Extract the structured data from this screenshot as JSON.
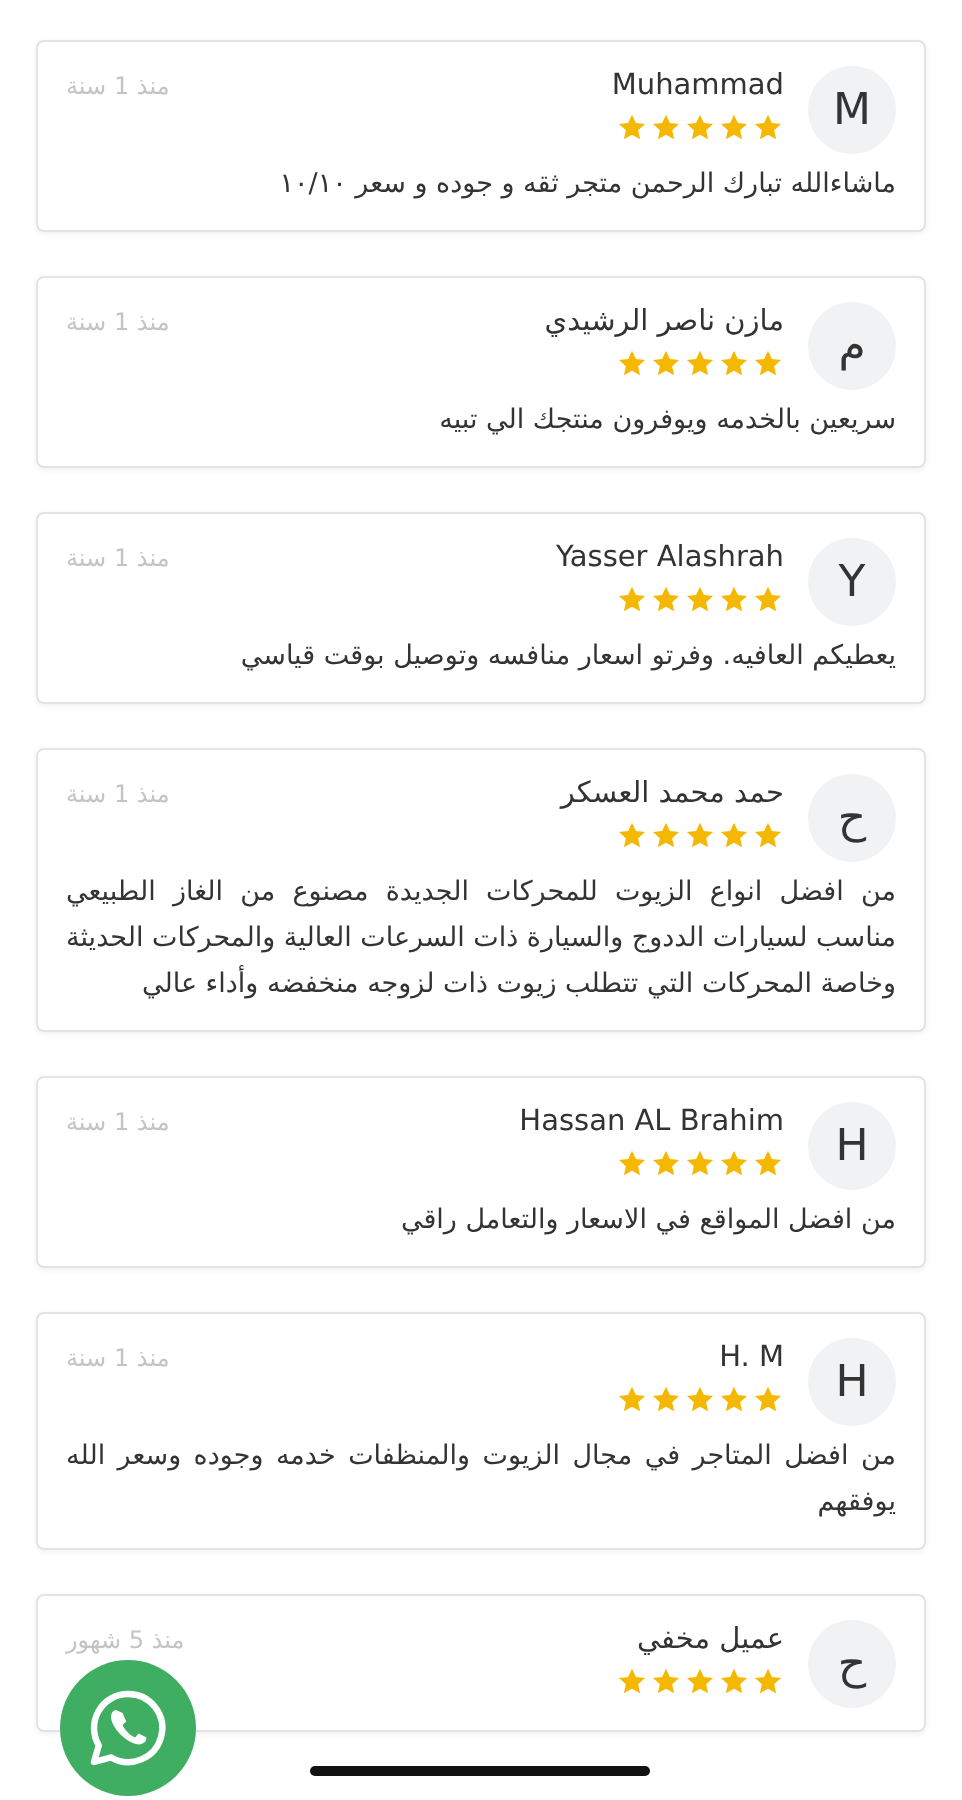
{
  "reviews": [
    {
      "avatar": "M",
      "name": "Muhammad",
      "stars": 5,
      "time": "منذ 1 سنة",
      "text": "ماشاءالله تبارك الرحمن متجر ثقه و جوده و سعر ١٠/١٠"
    },
    {
      "avatar": "م",
      "name": "مازن ناصر الرشيدي",
      "stars": 5,
      "time": "منذ 1 سنة",
      "text": "سريعين بالخدمه ويوفرون منتجك الي تبيه"
    },
    {
      "avatar": "Y",
      "name": "Yasser Alashrah",
      "stars": 5,
      "time": "منذ 1 سنة",
      "text": "يعطيكم العافيه. وفرتو اسعار منافسه وتوصيل بوقت قياسي"
    },
    {
      "avatar": "ح",
      "name": "حمد محمد العسكر",
      "stars": 5,
      "time": "منذ 1 سنة",
      "text": "من افضل انواع الزيوت للمحركات الجديدة مصنوع من الغاز الطبيعي مناسب لسيارات الددوج والسيارة ذات السرعات العالية والمحركات الحديثة وخاصة المحركات التي تتطلب زيوت ذات لزوجه منخفضه وأداء عالي"
    },
    {
      "avatar": "H",
      "name": "Hassan AL Brahim",
      "stars": 5,
      "time": "منذ 1 سنة",
      "text": "من افضل المواقع في الاسعار والتعامل راقي"
    },
    {
      "avatar": "H",
      "name": "H. M",
      "stars": 5,
      "time": "منذ 1 سنة",
      "text": "من افضل المتاجر في مجال الزيوت والمنظفات خدمه وجوده وسعر الله يوفقهم"
    },
    {
      "avatar": "ح",
      "name": "عميل مخفي",
      "stars": 5,
      "time": "منذ 5 شهور"
    }
  ]
}
